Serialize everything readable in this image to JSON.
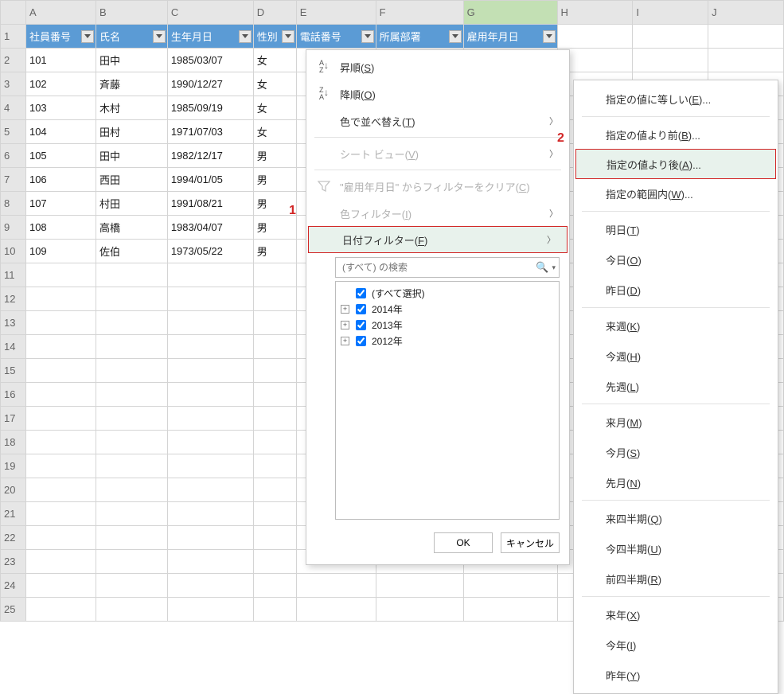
{
  "columns": [
    "A",
    "B",
    "C",
    "D",
    "E",
    "F",
    "G",
    "H",
    "I",
    "J"
  ],
  "headers": {
    "A": "社員番号",
    "B": "氏名",
    "C": "生年月日",
    "D": "性別",
    "E": "電話番号",
    "F": "所属部署",
    "G": "雇用年月日"
  },
  "rows": [
    {
      "no": "101",
      "name": "田中",
      "dob": "1985/03/07",
      "sex": "女"
    },
    {
      "no": "102",
      "name": "斉藤",
      "dob": "1990/12/27",
      "sex": "女"
    },
    {
      "no": "103",
      "name": "木村",
      "dob": "1985/09/19",
      "sex": "女"
    },
    {
      "no": "104",
      "name": "田村",
      "dob": "1971/07/03",
      "sex": "女"
    },
    {
      "no": "105",
      "name": "田中",
      "dob": "1982/12/17",
      "sex": "男"
    },
    {
      "no": "106",
      "name": "西田",
      "dob": "1994/01/05",
      "sex": "男"
    },
    {
      "no": "107",
      "name": "村田",
      "dob": "1991/08/21",
      "sex": "男"
    },
    {
      "no": "108",
      "name": "高橋",
      "dob": "1983/04/07",
      "sex": "男"
    },
    {
      "no": "109",
      "name": "佐伯",
      "dob": "1973/05/22",
      "sex": "男"
    }
  ],
  "filter_menu": {
    "sort_asc": "昇順(<u>S</u>)",
    "sort_desc": "降順(<u>O</u>)",
    "sort_by_color": "色で並べ替え(<u>T</u>)",
    "sheet_view": "シート ビュー(<u>V</u>)",
    "clear_filter": "\"雇用年月日\" からフィルターをクリア(<u>C</u>)",
    "color_filter": "色フィルター(<u>I</u>)",
    "date_filter": "日付フィルター(<u>F</u>)",
    "search_ph": "(すべて) の検索",
    "tree": {
      "all": "(すべて選択)",
      "y1": "2014年",
      "y2": "2013年",
      "y3": "2012年"
    },
    "ok": "OK",
    "cancel": "キャンセル"
  },
  "submenu": {
    "equals": "指定の値に等しい(<u>E</u>)...",
    "before": "指定の値より前(<u>B</u>)...",
    "after": "指定の値より後(<u>A</u>)...",
    "between": "指定の範囲内(<u>W</u>)...",
    "tomorrow": "明日(<u>T</u>)",
    "today": "今日(<u>O</u>)",
    "yesterday": "昨日(<u>D</u>)",
    "next_week": "来週(<u>K</u>)",
    "this_week": "今週(<u>H</u>)",
    "last_week": "先週(<u>L</u>)",
    "next_month": "来月(<u>M</u>)",
    "this_month": "今月(<u>S</u>)",
    "last_month": "先月(<u>N</u>)",
    "next_quarter": "来四半期(<u>Q</u>)",
    "this_quarter": "今四半期(<u>U</u>)",
    "last_quarter": "前四半期(<u>R</u>)",
    "next_year": "来年(<u>X</u>)",
    "this_year": "今年(<u>I</u>)",
    "last_year": "昨年(<u>Y</u>)"
  },
  "annot": {
    "a1": "1",
    "a2": "2"
  }
}
